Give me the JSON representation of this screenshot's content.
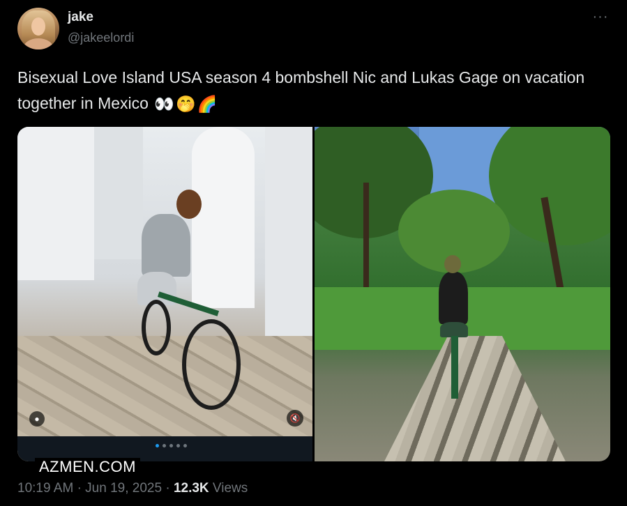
{
  "author": {
    "name": "jake",
    "handle": "@jakeelordi"
  },
  "more_icon": "more-horizontal-icon",
  "tweet": {
    "text": "Bisexual Love Island USA season 4 bombshell Nic and Lukas Gage on vacation together in Mexico",
    "emojis": [
      "👀",
      "🤭",
      "🌈"
    ]
  },
  "media": {
    "carousel_dots": 5,
    "active_dot": 0,
    "accent": "#1d9bf0",
    "photo1_icons": [
      "user-tag-icon",
      "mute-icon"
    ],
    "photo2_icons": [
      "mute-icon"
    ]
  },
  "watermark": "AZMEN.COM",
  "meta": {
    "time": "10:19 AM",
    "separator": "·",
    "date": "Jun 19, 2025",
    "views_count": "12.3K",
    "views_label": "Views"
  }
}
